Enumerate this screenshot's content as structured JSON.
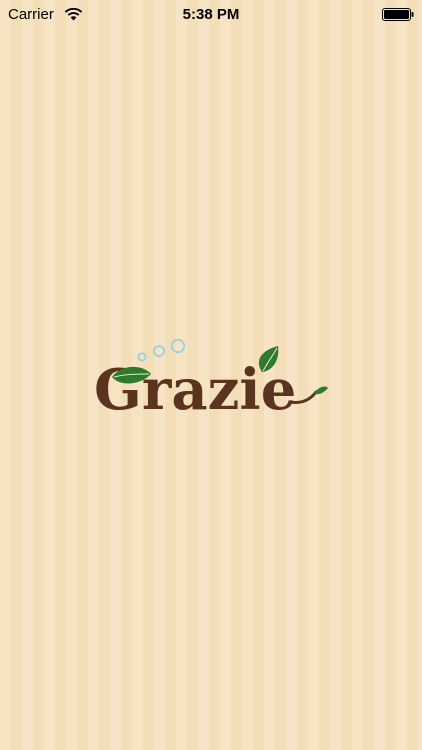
{
  "status_bar": {
    "carrier": "Carrier",
    "time": "5:38 PM",
    "wifi_icon": "wifi-icon",
    "battery_icon": "battery-full-icon"
  },
  "splash": {
    "logo_text": "Grazie",
    "logo_colors": {
      "text": "#5a341e",
      "leaf": "#2f7a2c",
      "bubble": "#9fd2e0"
    }
  },
  "colors": {
    "background": "#f6e1bd"
  }
}
